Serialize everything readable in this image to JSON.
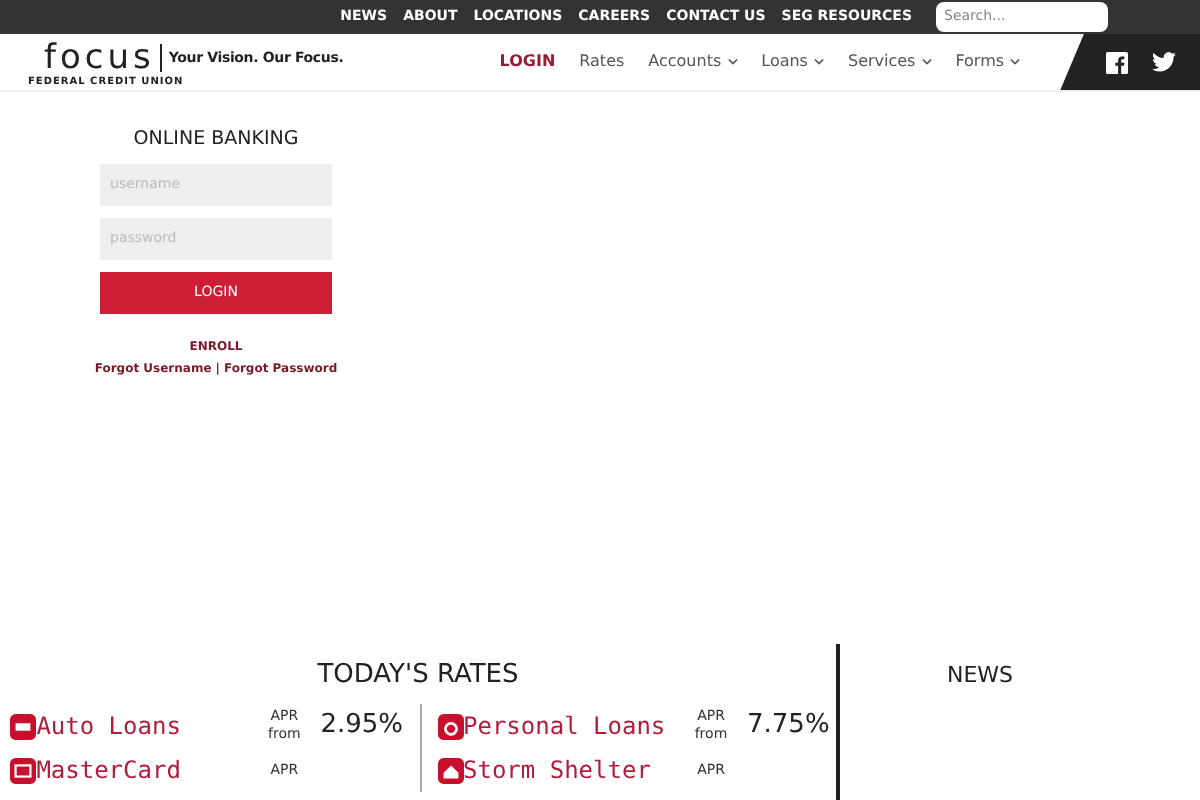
{
  "top_links": [
    "NEWS",
    "ABOUT",
    "LOCATIONS",
    "CAREERS",
    "CONTACT US",
    "SEG RESOURCES"
  ],
  "search": {
    "placeholder": "Search..."
  },
  "logo": {
    "name": "focus",
    "tagline": "Your Vision. Our Focus.",
    "subtitle": "FEDERAL CREDIT UNION"
  },
  "nav": [
    {
      "label": "LOGIN",
      "selected": true,
      "dropdown": false
    },
    {
      "label": "Rates",
      "selected": false,
      "dropdown": false
    },
    {
      "label": "Accounts",
      "selected": false,
      "dropdown": true
    },
    {
      "label": "Loans",
      "selected": false,
      "dropdown": true
    },
    {
      "label": "Services",
      "selected": false,
      "dropdown": true
    },
    {
      "label": "Forms",
      "selected": false,
      "dropdown": true
    }
  ],
  "login": {
    "title": "ONLINE BANKING",
    "username_placeholder": "username",
    "password_placeholder": "password",
    "button": "LOGIN",
    "enroll": "ENROLL",
    "forgot_username": "Forgot Username",
    "separator": "|",
    "forgot_password": "Forgot Password"
  },
  "rates": {
    "title": "TODAY'S RATES",
    "columns": [
      [
        {
          "kind": "car",
          "name": "Auto Loans",
          "apr": "APR",
          "from": "from",
          "rate": "2.95%"
        },
        {
          "kind": "card",
          "name": "MasterCard",
          "apr": "APR"
        }
      ],
      [
        {
          "kind": "ring",
          "name": "Personal Loans",
          "apr": "APR",
          "from": "from",
          "rate": "7.75%"
        },
        {
          "kind": "house",
          "name": "Storm Shelter",
          "apr": "APR"
        }
      ]
    ]
  },
  "news": {
    "title": "NEWS"
  }
}
